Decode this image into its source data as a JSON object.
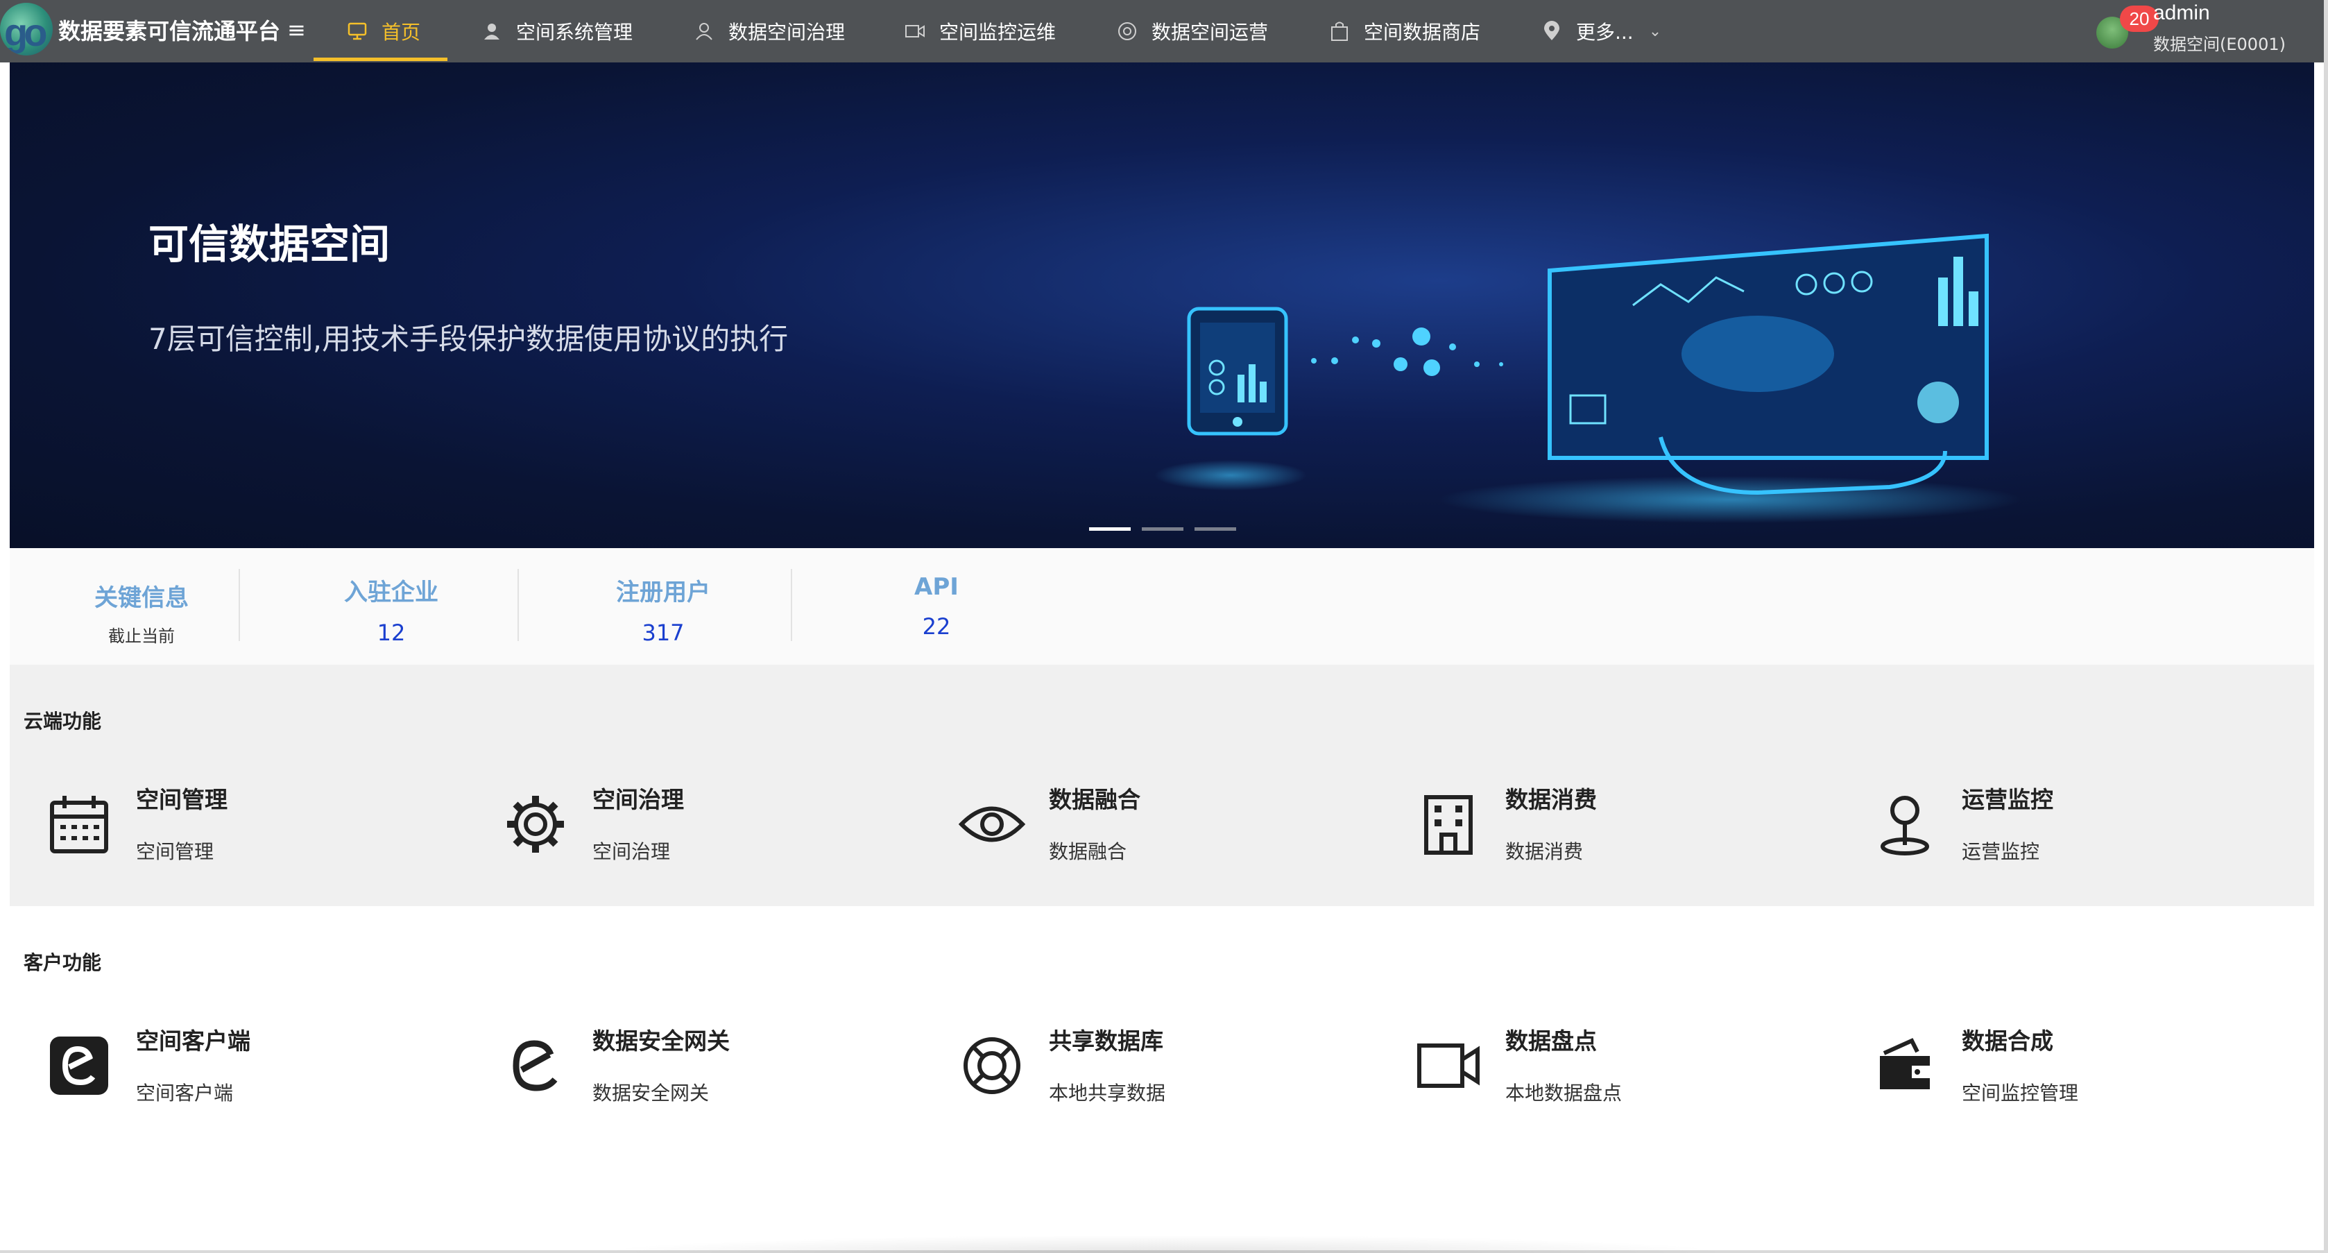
{
  "brand": {
    "logo_text": "go",
    "name": "数据要素可信流通平台"
  },
  "nav": {
    "items": [
      {
        "label": "首页",
        "icon": "monitor-icon",
        "active": true
      },
      {
        "label": "空间系统管理",
        "icon": "person-icon"
      },
      {
        "label": "数据空间治理",
        "icon": "user-outline-icon"
      },
      {
        "label": "空间监控运维",
        "icon": "video-icon"
      },
      {
        "label": "数据空间运营",
        "icon": "settings-circle-icon"
      },
      {
        "label": "空间数据商店",
        "icon": "bag-icon"
      },
      {
        "label": "更多...",
        "icon": "location-icon"
      }
    ]
  },
  "user": {
    "badge": "20",
    "name": "admin",
    "space": "数据空间(E0001)"
  },
  "banner": {
    "title": "可信数据空间",
    "subtitle": "7层可信控制,用技术手段保护数据使用协议的执行",
    "slides": 3,
    "active_slide": 0
  },
  "stats": {
    "key": {
      "label": "关键信息",
      "sub": "截止当前"
    },
    "items": [
      {
        "label": "入驻企业",
        "value": "12"
      },
      {
        "label": "注册用户",
        "value": "317"
      },
      {
        "label": "API",
        "value": "22"
      }
    ]
  },
  "cloud": {
    "title": "云端功能",
    "items": [
      {
        "title": "空间管理",
        "desc": "空间管理",
        "icon": "calendar-icon"
      },
      {
        "title": "空间治理",
        "desc": "空间治理",
        "icon": "gear-icon"
      },
      {
        "title": "数据融合",
        "desc": "数据融合",
        "icon": "eye-icon"
      },
      {
        "title": "数据消费",
        "desc": "数据消费",
        "icon": "building-icon"
      },
      {
        "title": "运营监控",
        "desc": "运营监控",
        "icon": "map-pin-icon"
      }
    ]
  },
  "client": {
    "title": "客户功能",
    "items": [
      {
        "title": "空间客户端",
        "desc": "空间客户端",
        "icon": "e-square-icon"
      },
      {
        "title": "数据安全网关",
        "desc": "数据安全网关",
        "icon": "e-icon"
      },
      {
        "title": "共享数据库",
        "desc": "本地共享数据",
        "icon": "lifebuoy-icon"
      },
      {
        "title": "数据盘点",
        "desc": "本地数据盘点",
        "icon": "video-camera-icon"
      },
      {
        "title": "数据合成",
        "desc": "空间监控管理",
        "icon": "wallet-icon"
      }
    ]
  }
}
